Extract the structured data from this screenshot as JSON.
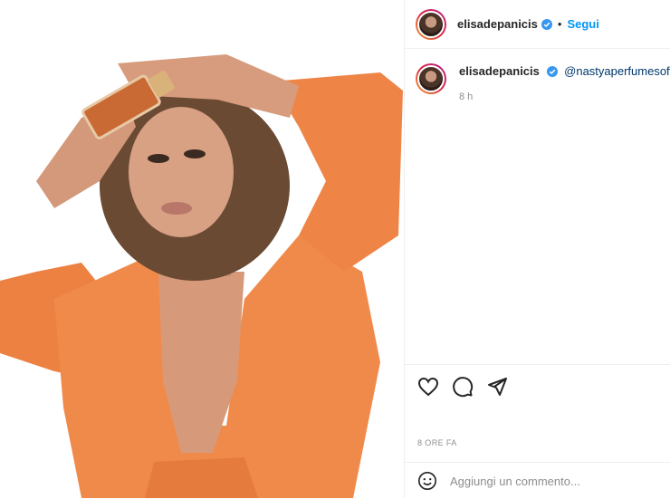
{
  "post": {
    "author": {
      "username": "elisadepanicis",
      "verified": true
    },
    "follow_label": "Segui",
    "separator": "•",
    "caption": {
      "username": "elisadepanicis",
      "mention": "@nastyaperfumesofficial",
      "time": "8 h"
    },
    "timestamp": "8 ORE FA",
    "comment_placeholder": "Aggiungi un commento...",
    "image": {
      "description_icon": "photo-image"
    }
  },
  "colors": {
    "accent": "#0095f6",
    "jacket": "#f08a4b",
    "background": "#ffffff"
  }
}
